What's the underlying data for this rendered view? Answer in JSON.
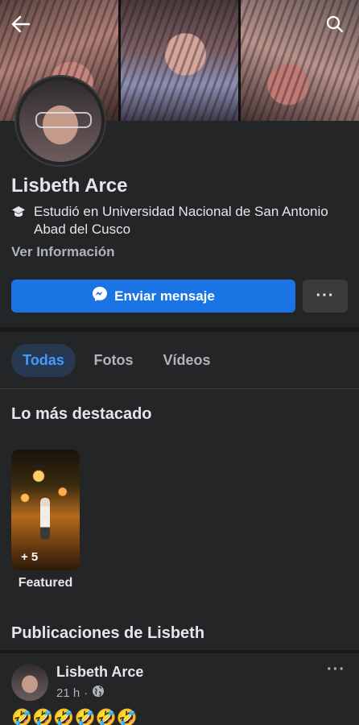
{
  "profile": {
    "name": "Lisbeth Arce",
    "education": "Estudió en Universidad Nacional de San Antonio Abad del Cusco",
    "ver_info": "Ver Información",
    "message_button": "Enviar mensaje",
    "more_button": "···"
  },
  "tabs": [
    {
      "label": "Todas",
      "active": true
    },
    {
      "label": "Fotos",
      "active": false
    },
    {
      "label": "Vídeos",
      "active": false
    }
  ],
  "highlights": {
    "title": "Lo más destacado",
    "items": [
      {
        "count": "+ 5",
        "label": "Featured"
      }
    ]
  },
  "posts_section": {
    "title": "Publicaciones de Lisbeth"
  },
  "post": {
    "author": "Lisbeth Arce",
    "time": "21 h",
    "separator": "·",
    "privacy_icon": "globe-icon",
    "more": "···",
    "text": "🤣🤣🤣🤣🤣🤣"
  },
  "colors": {
    "background": "#242526",
    "primary_button": "#1b74e4",
    "active_tab_bg": "#263951",
    "active_tab_text": "#4599ff",
    "secondary_text": "#b0b3b8"
  }
}
